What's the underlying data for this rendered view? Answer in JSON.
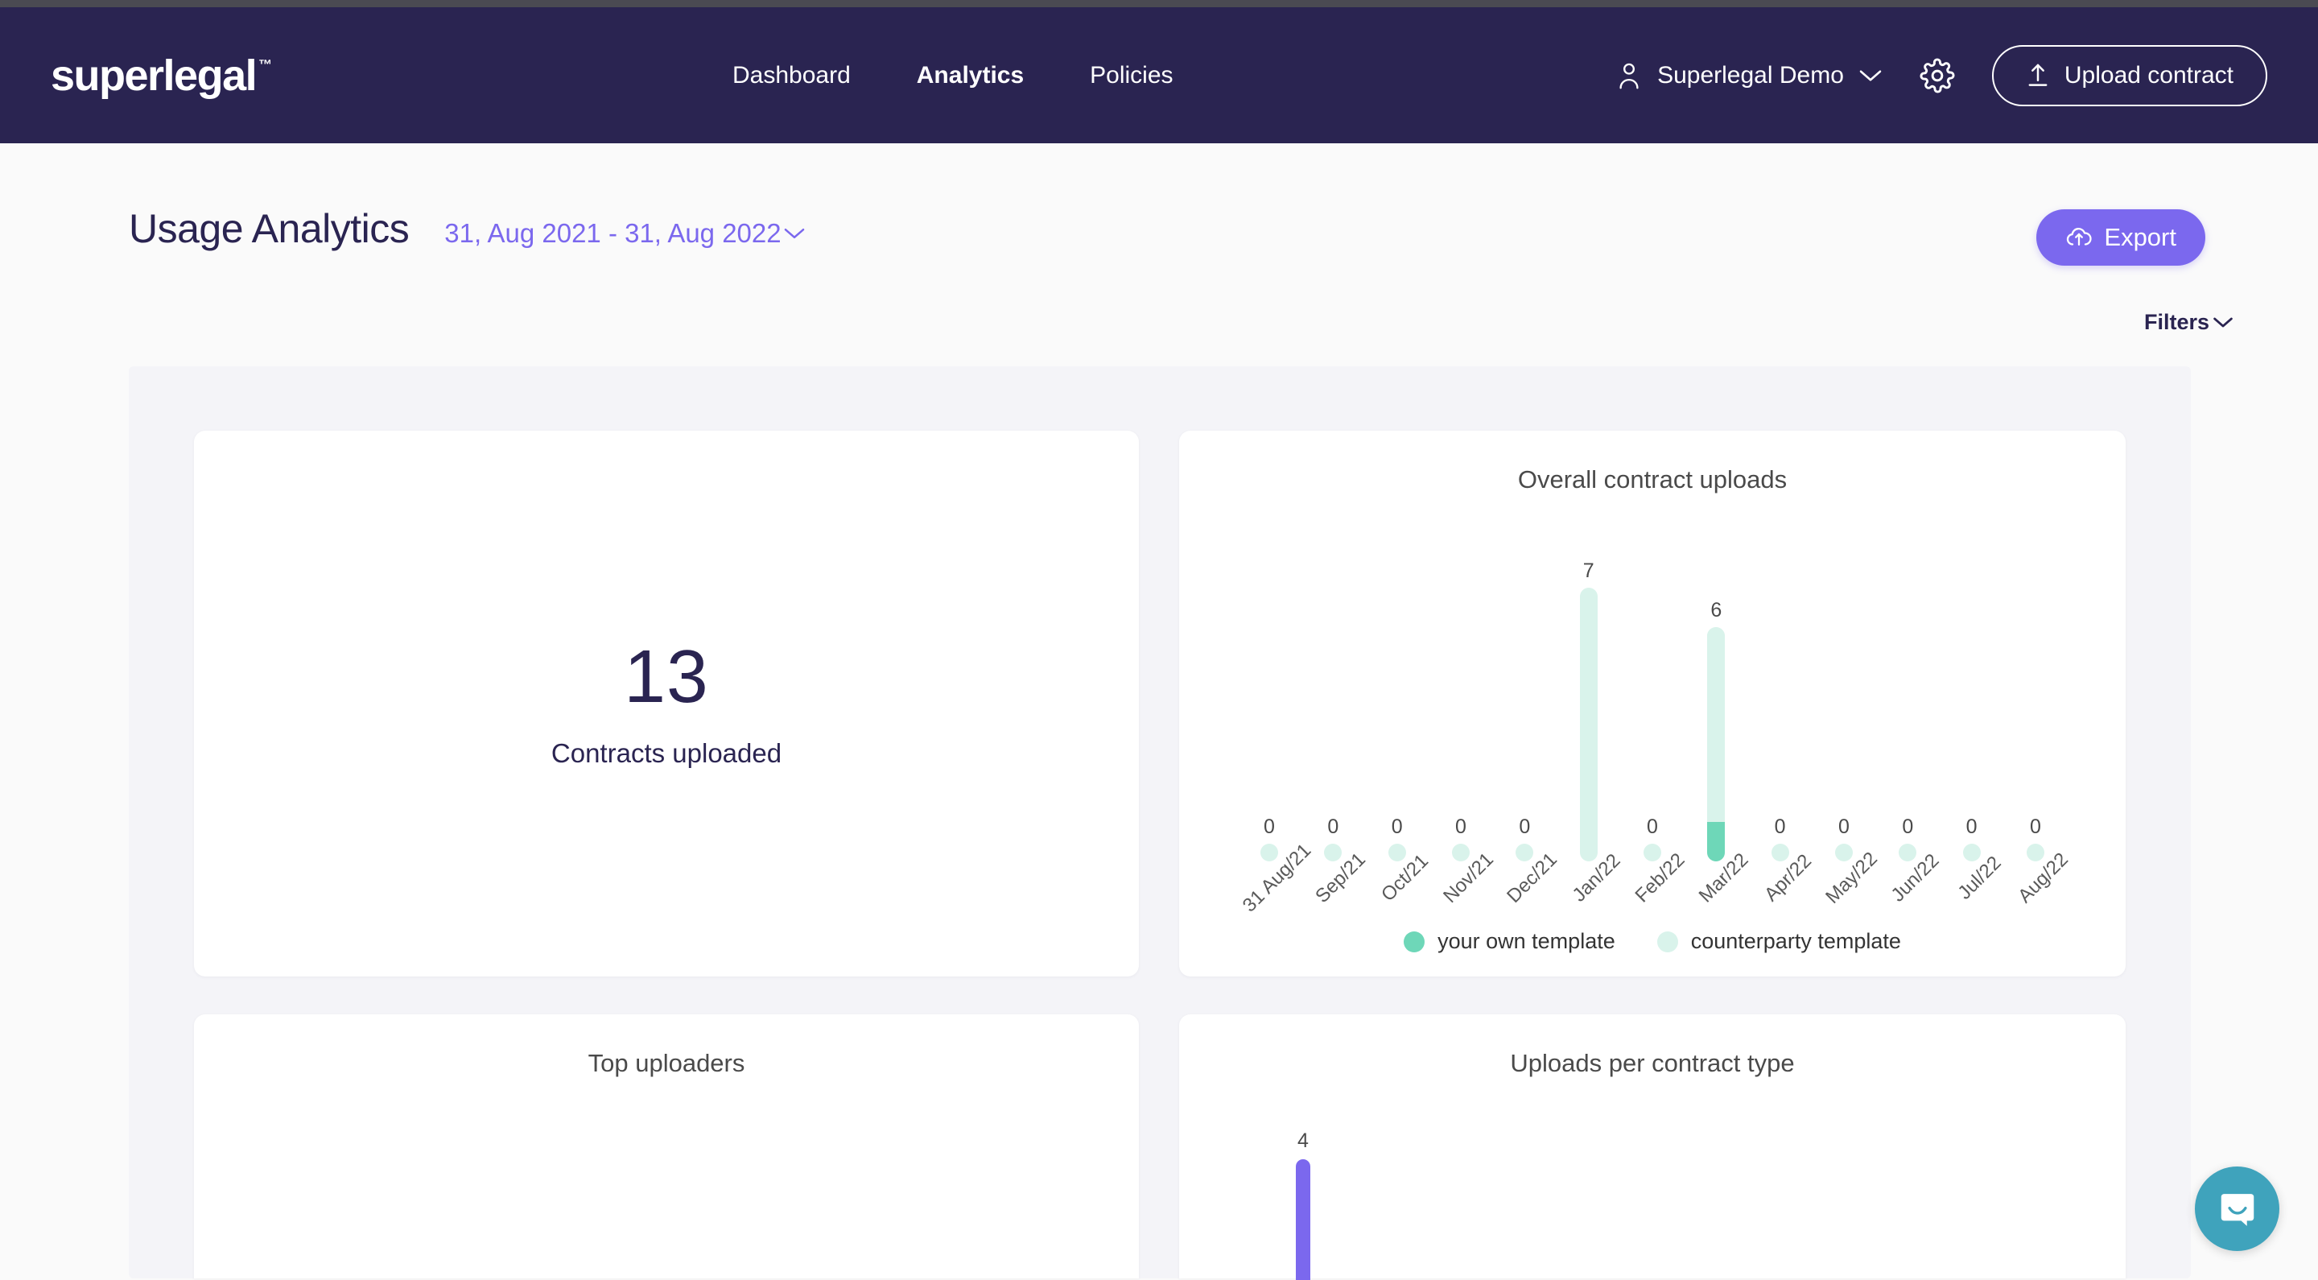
{
  "header": {
    "logo_text": "superlegal",
    "logo_tm": "™",
    "nav": [
      {
        "label": "Dashboard",
        "active": false
      },
      {
        "label": "Analytics",
        "active": true
      },
      {
        "label": "Policies",
        "active": false
      }
    ],
    "user_name": "Superlegal Demo",
    "user_icon": "person-icon",
    "chevron_icon": "chevron-down-icon",
    "gear_icon": "gear-icon",
    "upload_icon": "upload-arrow-icon",
    "upload_label": "Upload contract",
    "bg_color": "#2A2451"
  },
  "page": {
    "title": "Usage Analytics",
    "date_range": "31, Aug 2021 - 31, Aug 2022",
    "date_chevron_icon": "chevron-down-icon",
    "export_label": "Export",
    "export_icon": "cloud-upload-icon",
    "export_color": "#7B68EE",
    "filters_label": "Filters",
    "filters_chevron_icon": "chevron-down-icon"
  },
  "kpi": {
    "value": "13",
    "label": "Contracts uploaded"
  },
  "cards": {
    "overall_title": "Overall contract uploads",
    "top_uploaders_title": "Top uploaders",
    "uploads_per_type_title": "Uploads per contract type"
  },
  "chart_data": [
    {
      "type": "bar",
      "title": "Overall contract uploads",
      "stacked": true,
      "categories": [
        "31 Aug/21",
        "Sep/21",
        "Oct/21",
        "Nov/21",
        "Dec/21",
        "Jan/22",
        "Feb/22",
        "Mar/22",
        "Apr/22",
        "May/22",
        "Jun/22",
        "Jul/22",
        "Aug/22"
      ],
      "totals": [
        0,
        0,
        0,
        0,
        0,
        7,
        0,
        6,
        0,
        0,
        0,
        0,
        0
      ],
      "series": [
        {
          "name": "your own template",
          "color": "#6ED7B8",
          "values": [
            0,
            0,
            0,
            0,
            0,
            0,
            0,
            1,
            0,
            0,
            0,
            0,
            0
          ]
        },
        {
          "name": "counterparty template",
          "color": "#D9F3EB",
          "values": [
            0,
            0,
            0,
            0,
            0,
            7,
            0,
            5,
            0,
            0,
            0,
            0,
            0
          ]
        }
      ],
      "data_labels": [
        "0",
        "0",
        "0",
        "0",
        "0",
        "7",
        "0",
        "6",
        "0",
        "0",
        "0",
        "0",
        "0"
      ],
      "ylim": [
        0,
        7
      ],
      "grid": false,
      "legend_position": "bottom",
      "xlabel": "",
      "ylabel": ""
    },
    {
      "type": "bar",
      "title": "Uploads per contract type",
      "categories": [
        ""
      ],
      "values": [
        4
      ],
      "data_labels": [
        "4"
      ],
      "color": "#7B68EE",
      "ylim": [
        0,
        4
      ],
      "grid": false,
      "xlabel": "",
      "ylabel": ""
    }
  ],
  "widgets": {
    "intercom_icon": "chat-bubble-icon",
    "intercom_color": "#3FA3BC"
  }
}
